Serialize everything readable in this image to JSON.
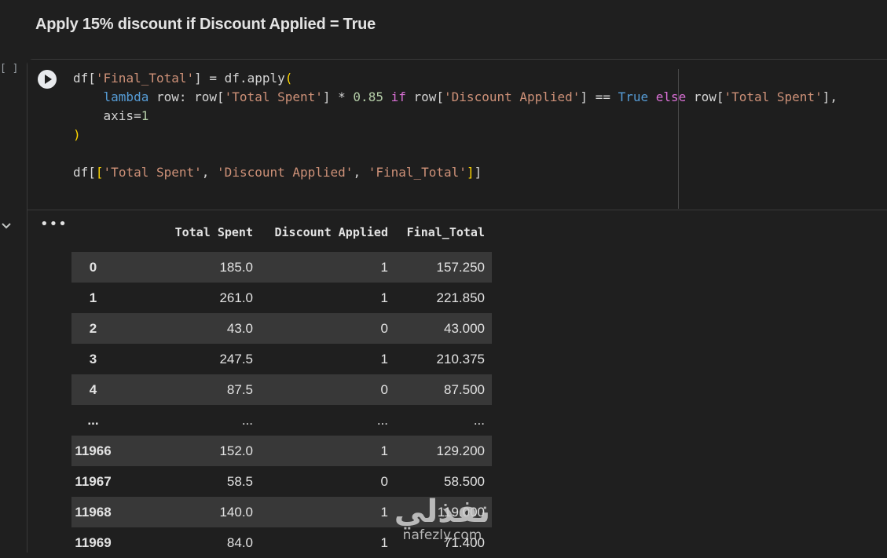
{
  "heading": "Apply 15% discount if Discount Applied = True",
  "gutter": {
    "exec_count": "[ ]"
  },
  "code_lines": [
    [
      [
        "df[",
        ""
      ],
      [
        "'Final_Total'",
        "str"
      ],
      [
        "] = df.apply",
        ""
      ],
      [
        "(",
        "b1"
      ]
    ],
    [
      [
        "    ",
        ""
      ],
      [
        "lambda",
        "kw"
      ],
      [
        " row: row[",
        ""
      ],
      [
        "'Total Spent'",
        "str"
      ],
      [
        "] * ",
        ""
      ],
      [
        "0.85",
        "num"
      ],
      [
        " ",
        ""
      ],
      [
        "if",
        "b2"
      ],
      [
        " row[",
        ""
      ],
      [
        "'Discount Applied'",
        "str"
      ],
      [
        "] == ",
        ""
      ],
      [
        "True",
        "kw"
      ],
      [
        " ",
        ""
      ],
      [
        "else",
        "b2"
      ],
      [
        " row[",
        ""
      ],
      [
        "'Total Spent'",
        "str"
      ],
      [
        "],",
        ""
      ]
    ],
    [
      [
        "    axis=",
        ""
      ],
      [
        "1",
        "num"
      ]
    ],
    [
      [
        ")",
        "b1"
      ]
    ],
    [
      [
        "",
        ""
      ]
    ],
    [
      [
        "df[",
        ""
      ],
      [
        "[",
        "b1"
      ],
      [
        "'Total Spent'",
        "str"
      ],
      [
        ", ",
        ""
      ],
      [
        "'Discount Applied'",
        "str"
      ],
      [
        ", ",
        ""
      ],
      [
        "'Final_Total'",
        "str"
      ],
      [
        "]",
        "b1"
      ],
      [
        "]",
        ""
      ]
    ]
  ],
  "output": {
    "more_label": "•••",
    "columns": [
      "",
      "Total Spent",
      "Discount Applied",
      "Final_Total"
    ],
    "rows": [
      [
        "0",
        "185.0",
        "1",
        "157.250"
      ],
      [
        "1",
        "261.0",
        "1",
        "221.850"
      ],
      [
        "2",
        "43.0",
        "0",
        "43.000"
      ],
      [
        "3",
        "247.5",
        "1",
        "210.375"
      ],
      [
        "4",
        "87.5",
        "0",
        "87.500"
      ],
      [
        "...",
        "...",
        "...",
        "..."
      ],
      [
        "11966",
        "152.0",
        "1",
        "129.200"
      ],
      [
        "11967",
        "58.5",
        "0",
        "58.500"
      ],
      [
        "11968",
        "140.0",
        "1",
        "119.000"
      ],
      [
        "11969",
        "84.0",
        "1",
        "71.400"
      ]
    ]
  },
  "watermark": {
    "arabic": "نفذلي",
    "latin": "nafezly.com"
  }
}
